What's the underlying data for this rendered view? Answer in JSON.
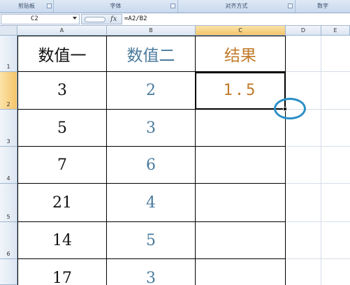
{
  "ribbon": {
    "groups": [
      "剪贴板",
      "字体",
      "对齐方式",
      "数字"
    ]
  },
  "formula_bar": {
    "name_box": "C2",
    "fx_label": "fx",
    "formula": "=A2/B2"
  },
  "columns": [
    "A",
    "B",
    "C",
    "D",
    "E"
  ],
  "selected_column": "C",
  "rows": [
    {
      "num": "1",
      "a": "数值一",
      "b": "数值二",
      "c": "结果"
    },
    {
      "num": "2",
      "a": "3",
      "b": "2",
      "c": "1.5"
    },
    {
      "num": "3",
      "a": "5",
      "b": "3",
      "c": ""
    },
    {
      "num": "4",
      "a": "7",
      "b": "6",
      "c": ""
    },
    {
      "num": "5",
      "a": "21",
      "b": "4",
      "c": ""
    },
    {
      "num": "6",
      "a": "14",
      "b": "5",
      "c": ""
    },
    {
      "num": "",
      "a": "17",
      "b": "3",
      "c": ""
    }
  ],
  "selected_row": "2",
  "colors": {
    "col_a_text": "#111111",
    "col_b_text": "#4a7a9c",
    "col_c_text": "#c07a2a",
    "highlight_circle": "#2b8fc6",
    "selected_header": "#f4c46a"
  }
}
